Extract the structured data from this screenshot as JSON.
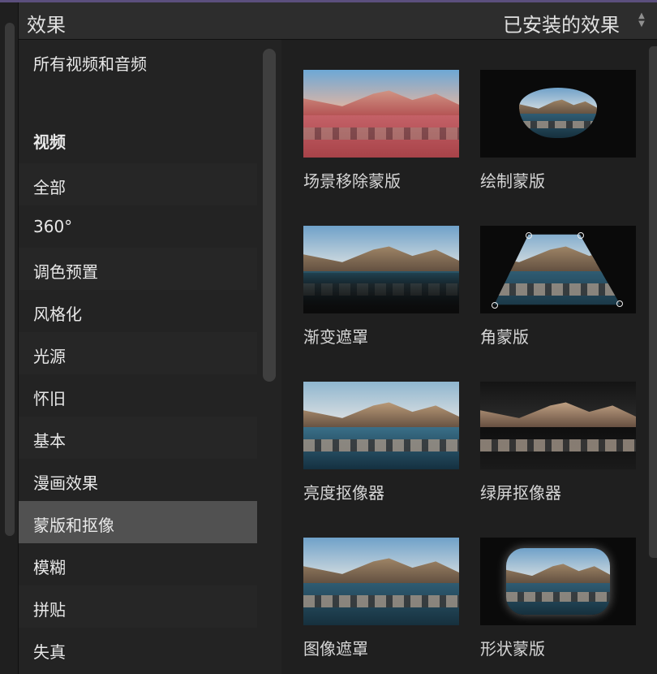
{
  "left_panel": {
    "title": "效果"
  },
  "right_panel": {
    "title": "已安装的效果"
  },
  "categories": [
    {
      "label": "所有视频和音频"
    },
    {
      "label": "视频"
    },
    {
      "label": "全部"
    },
    {
      "label": "360°"
    },
    {
      "label": "调色预置"
    },
    {
      "label": "风格化"
    },
    {
      "label": "光源"
    },
    {
      "label": "怀旧"
    },
    {
      "label": "基本"
    },
    {
      "label": "漫画效果"
    },
    {
      "label": "蒙版和抠像"
    },
    {
      "label": "模糊"
    },
    {
      "label": "拼贴"
    },
    {
      "label": "失真"
    }
  ],
  "effects": [
    {
      "label": "场景移除蒙版"
    },
    {
      "label": "绘制蒙版"
    },
    {
      "label": "渐变遮罩"
    },
    {
      "label": "角蒙版"
    },
    {
      "label": "亮度抠像器"
    },
    {
      "label": "绿屏抠像器"
    },
    {
      "label": "图像遮罩"
    },
    {
      "label": "形状蒙版"
    }
  ],
  "colors": {
    "selected_row": "#515151",
    "panel_bg": "#232323"
  }
}
